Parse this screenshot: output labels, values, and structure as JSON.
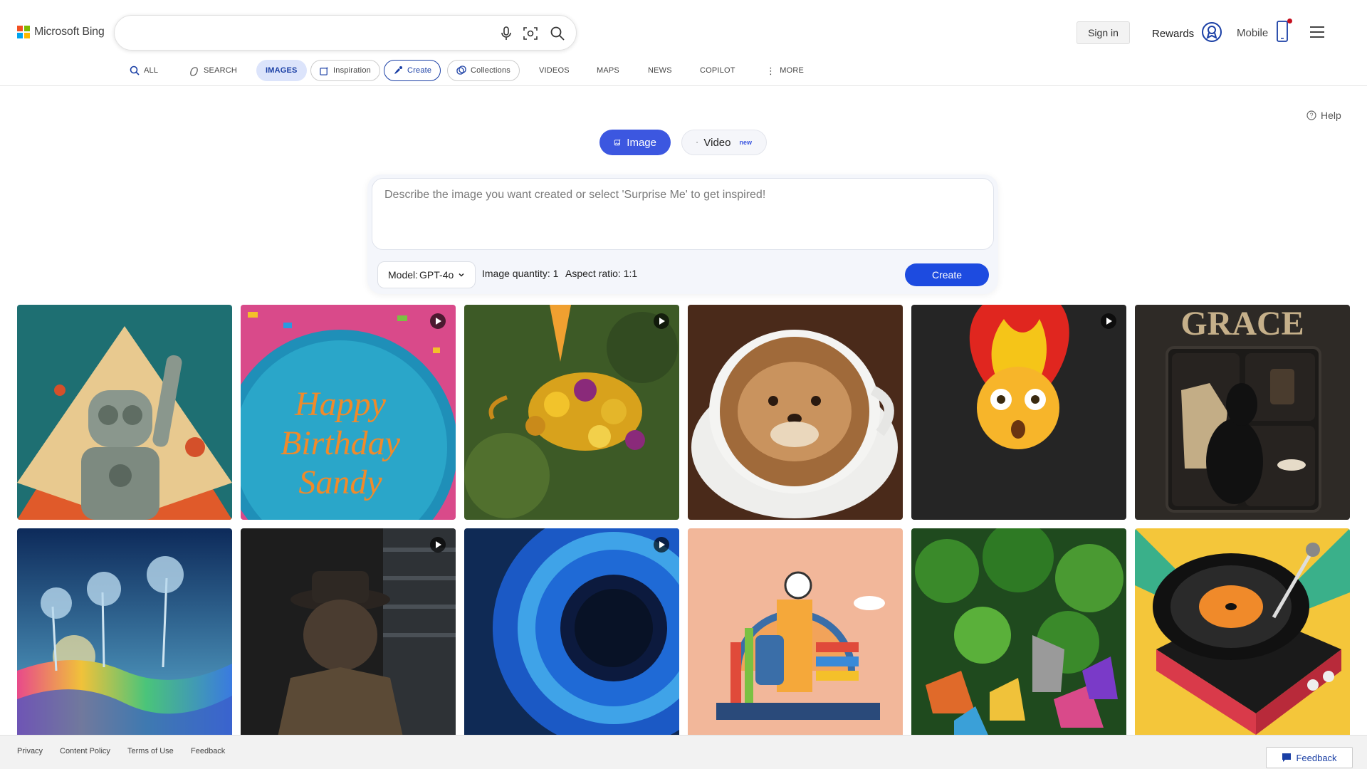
{
  "brand": {
    "name": "Microsoft Bing",
    "colors": [
      "#f25022",
      "#7fba00",
      "#00a4ef",
      "#ffb900"
    ]
  },
  "search": {
    "placeholder": ""
  },
  "header": {
    "sign_in": "Sign in",
    "rewards": "Rewards",
    "mobile": "Mobile"
  },
  "nav": {
    "all": "ALL",
    "search": "SEARCH",
    "images": "IMAGES",
    "inspiration": "Inspiration",
    "create": "Create",
    "collections": "Collections",
    "videos": "VIDEOS",
    "maps": "MAPS",
    "news": "NEWS",
    "copilot": "COPILOT",
    "more": "MORE"
  },
  "help": "Help",
  "modes": {
    "image": "Image",
    "video": "Video",
    "video_badge": "new"
  },
  "creator": {
    "prompt_placeholder": "Describe the image you want created or select 'Surprise Me' to get inspired!",
    "model_label": "Model:",
    "model_value": "GPT-4o",
    "quantity": "Image quantity: 1",
    "aspect": "Aspect ratio: 1:1",
    "create": "Create"
  },
  "gallery": [
    {
      "subject": "retro robot waving",
      "video": false
    },
    {
      "subject": "Happy Birthday Sandy cake",
      "video": true
    },
    {
      "subject": "hummingbird made of flowers",
      "video": true
    },
    {
      "subject": "otter latte art",
      "video": false
    },
    {
      "subject": "shocked emoji with exploding head",
      "video": true
    },
    {
      "subject": "GRACE dog on shelf",
      "video": false
    },
    {
      "subject": "rainbow dunes with palm trees",
      "video": false
    },
    {
      "subject": "bulldog detective in trench coat",
      "video": true
    },
    {
      "subject": "blue eye close-up",
      "video": true
    },
    {
      "subject": "school supplies city",
      "video": false
    },
    {
      "subject": "origami jungle animals",
      "video": false
    },
    {
      "subject": "pop art record player",
      "video": false
    }
  ],
  "tile_texts": {
    "cake_line1": "Happy",
    "cake_line2": "Birthday",
    "cake_line3": "Sandy",
    "grace": "GRACE"
  },
  "footer": {
    "privacy": "Privacy",
    "content_policy": "Content Policy",
    "terms": "Terms of Use",
    "feedback": "Feedback",
    "feedback_button": "Feedback"
  }
}
